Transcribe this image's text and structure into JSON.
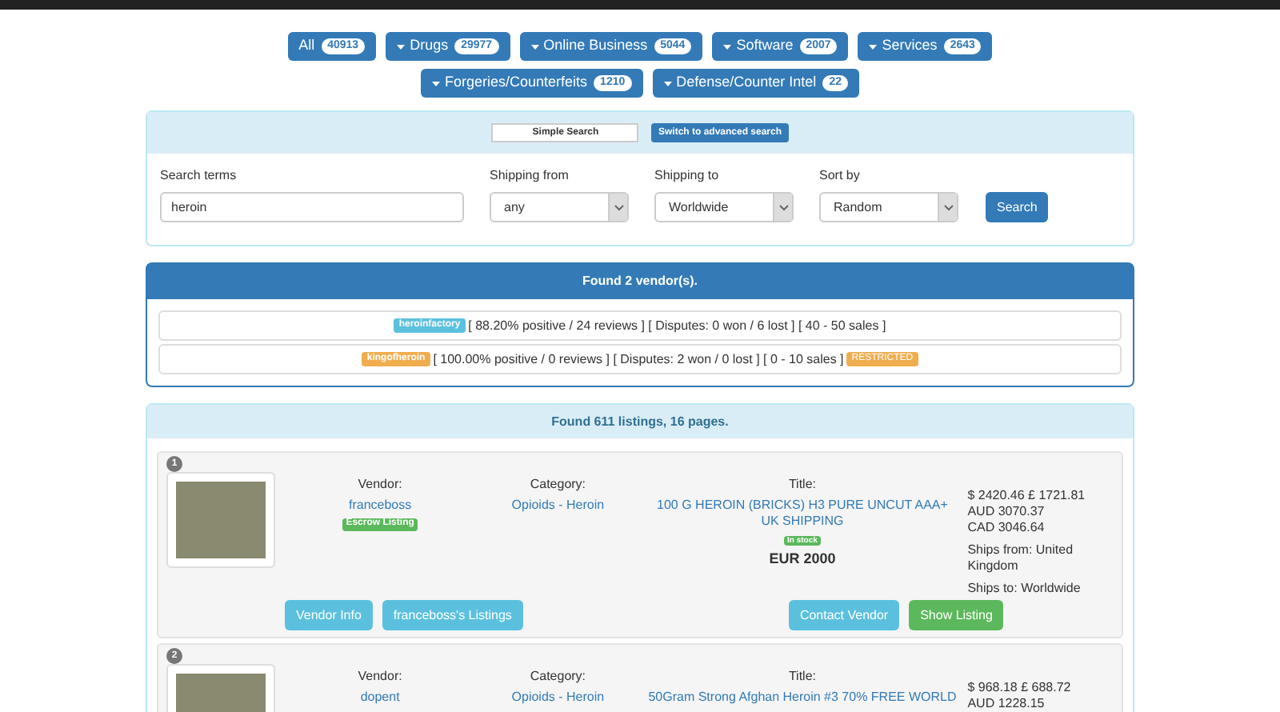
{
  "categories": [
    {
      "label": "All",
      "count": "40913",
      "caret": false
    },
    {
      "label": "Drugs",
      "count": "29977",
      "caret": true
    },
    {
      "label": "Online Business",
      "count": "5044",
      "caret": true
    },
    {
      "label": "Software",
      "count": "2007",
      "caret": true
    },
    {
      "label": "Services",
      "count": "2643",
      "caret": true
    },
    {
      "label": "Forgeries/Counterfeits",
      "count": "1210",
      "caret": true
    },
    {
      "label": "Defense/Counter Intel",
      "count": "22",
      "caret": true
    }
  ],
  "search": {
    "modes": [
      {
        "label": "Simple Search",
        "selected": true
      },
      {
        "label": "Switch to advanced search",
        "selected": false
      }
    ],
    "fields": [
      {
        "kind": "text",
        "label": "Search terms",
        "value": "heroin"
      },
      {
        "kind": "select",
        "label": "Shipping from",
        "value": "any"
      },
      {
        "kind": "select",
        "label": "Shipping to",
        "value": "Worldwide"
      },
      {
        "kind": "select",
        "label": "Sort by",
        "value": "Random"
      }
    ],
    "button": "Search"
  },
  "vendors": {
    "title": "Found 2 vendor(s).",
    "items": [
      {
        "name": "heroinfactory",
        "color": "#5bc0de",
        "stats": "[ 88.20% positive / 24 reviews ] [ Disputes: 0 won / 6 lost ] [ 40 - 50 sales ]"
      },
      {
        "name": "kingofheroin",
        "color": "#f0ad4e",
        "stats": "[ 100.00% positive / 0 reviews ] [ Disputes: 2 won / 0 lost ] [ 0 - 10 sales ]",
        "badge": "RESTRICTED"
      }
    ]
  },
  "listings": {
    "title": "Found 611 listings, 16 pages.",
    "items": [
      {
        "number": "1",
        "vendor_label": "Vendor:",
        "vendor": "franceboss",
        "escrow": "Escrow Listing",
        "category_label": "Category:",
        "category": "Opioids - Heroin",
        "title_label": "Title:",
        "title": "100 G HEROIN (BRICKS) H3 PURE UNCUT AAA+ UK SHIPPING",
        "stock": "In stock",
        "price": "EUR 2000",
        "prices": [
          "$ 2420.46 £ 1721.81",
          "AUD 3070.37",
          "CAD 3046.64"
        ],
        "ships_from": "Ships from: United Kingdom",
        "ships_to": "Ships to: Worldwide",
        "buttons": [
          {
            "kind": "info",
            "label": "Vendor Info"
          },
          {
            "kind": "info",
            "label": "franceboss's Listings"
          },
          {
            "kind": "gap"
          },
          {
            "kind": "info",
            "label": "Contact Vendor"
          },
          {
            "kind": "success",
            "label": "Show Listing"
          }
        ]
      },
      {
        "number": "2",
        "vendor_label": "Vendor:",
        "vendor": "dopent",
        "category_label": "Category:",
        "category": "Opioids - Heroin",
        "title_label": "Title:",
        "title": "50Gram Strong Afghan Heroin #3 70% FREE WORLD",
        "prices": [
          "$ 968.18 £ 688.72",
          "AUD 1228.15"
        ]
      }
    ]
  }
}
